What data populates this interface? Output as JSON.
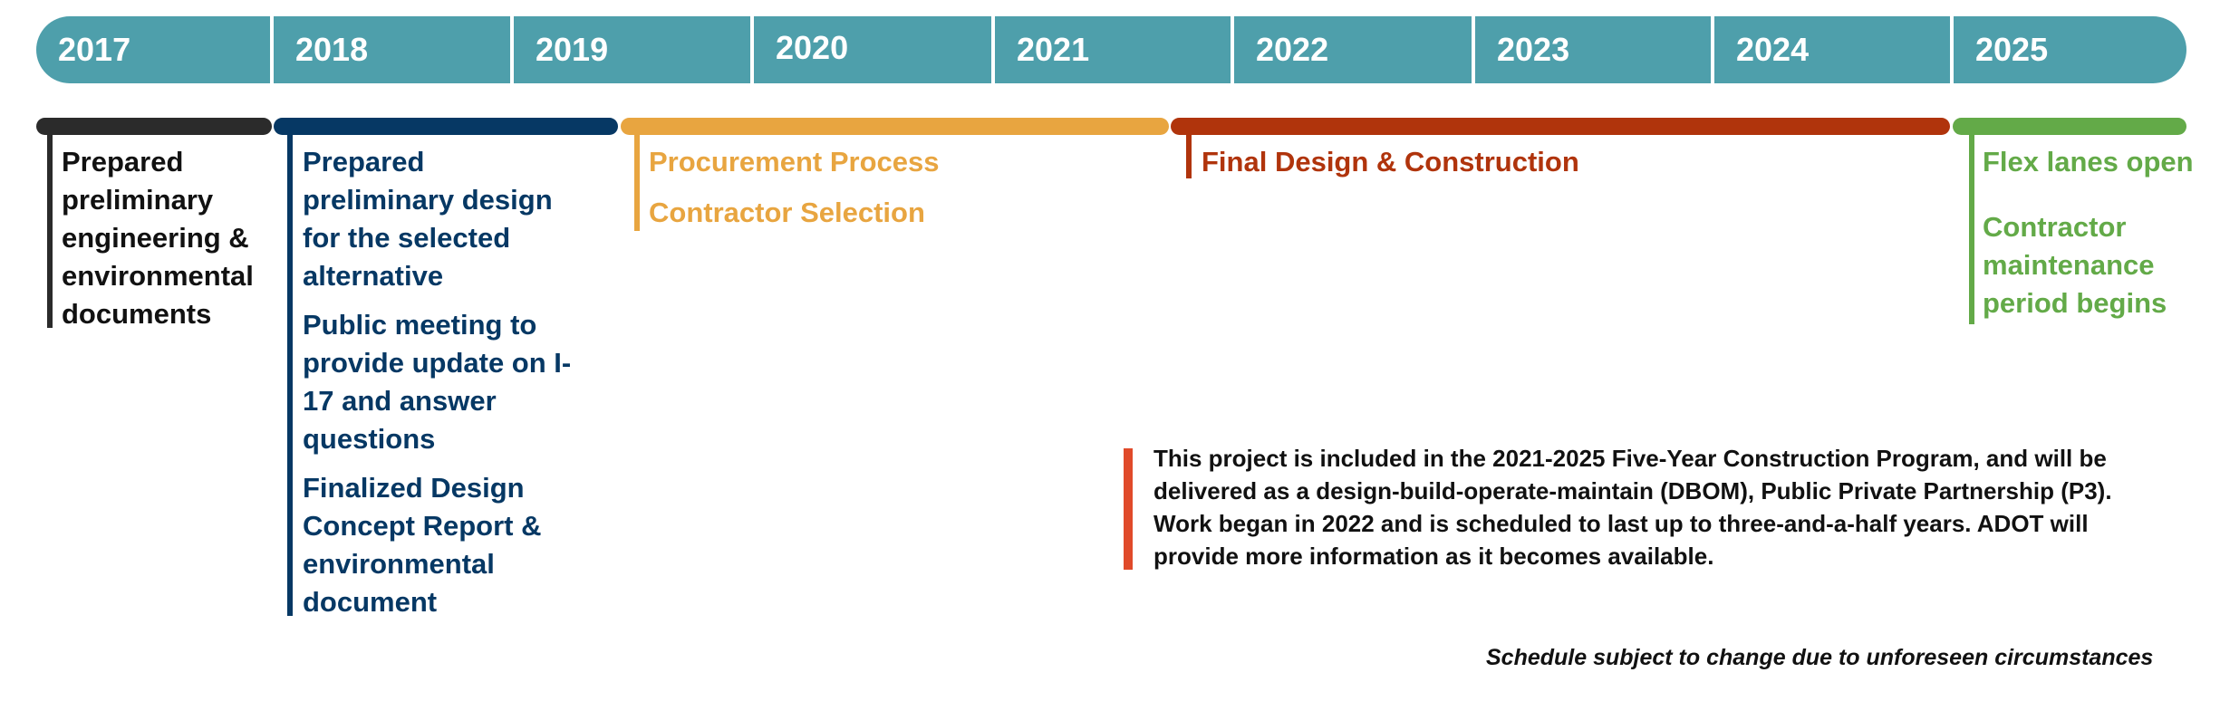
{
  "years": [
    "2017",
    "2018",
    "2019",
    "2020",
    "2021",
    "2022",
    "2023",
    "2024",
    "2025"
  ],
  "phases": [
    {
      "name": "preliminary-engineering",
      "color": "#2b2b2b",
      "span": "2017",
      "items": [
        "Prepared preliminary engineering & environmental documents"
      ]
    },
    {
      "name": "preliminary-design",
      "color": "#063864",
      "span": "2018–mid 2019",
      "items": [
        "Prepared preliminary design for the selected alternative",
        "Public meeting to provide update on I-17 and answer questions",
        "Finalized Design Concept Report & environmental document"
      ]
    },
    {
      "name": "procurement",
      "color": "#e8a540",
      "span": "mid 2019–2021",
      "items": [
        "Procurement Process",
        "Contractor Selection"
      ]
    },
    {
      "name": "final-design-construction",
      "color": "#b0340c",
      "span": "2021–2024",
      "items": [
        "Final Design & Construction"
      ]
    },
    {
      "name": "flex-lanes",
      "color": "#63aa48",
      "span": "2025",
      "items": [
        "Flex lanes open",
        "Contractor maintenance period begins"
      ]
    }
  ],
  "note": {
    "accent_color": "#e04a2a",
    "text": "This project is included in the 2021-2025 Five-Year Construction Program, and will be delivered as a design-build-operate-maintain (DBOM), Public Private Partnership (P3). Work began in 2022 and is scheduled to last up to three-and-a-half years. ADOT will provide more information as it becomes available."
  },
  "disclaimer": "Schedule subject to change due to unforeseen circumstances",
  "colors": {
    "year_band": "#4e9fab"
  }
}
